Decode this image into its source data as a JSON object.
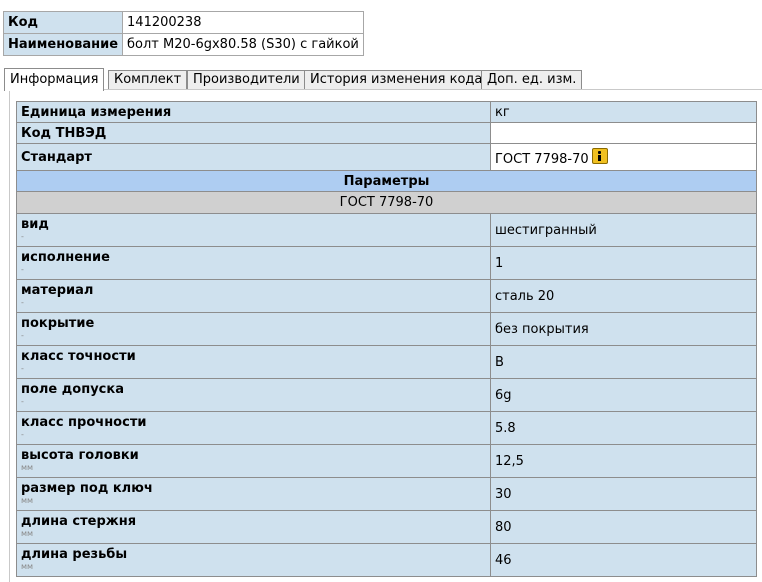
{
  "header": {
    "code_label": "Код",
    "code_value": "141200238",
    "name_label": "Наименование",
    "name_value": "болт М20-6gx80.58 (S30) с гайкой"
  },
  "tabs": [
    {
      "label": "Информация",
      "active": true
    },
    {
      "label": "Комплект",
      "active": false
    },
    {
      "label": "Производители",
      "active": false
    },
    {
      "label": "История изменения кода",
      "active": false
    },
    {
      "label": "Доп. ед. изм.",
      "active": false
    }
  ],
  "info": {
    "unit_label": "Единица измерения",
    "unit_value": "кг",
    "tnved_label": "Код ТНВЭД",
    "tnved_value": "",
    "standard_label": "Стандарт",
    "standard_value": "ГОСТ 7798-70"
  },
  "params_section": {
    "title": "Параметры",
    "standard": "ГОСТ 7798-70"
  },
  "params": [
    {
      "name": "вид",
      "unit": "-",
      "value": "шестигранный"
    },
    {
      "name": "исполнение",
      "unit": "-",
      "value": "1"
    },
    {
      "name": "материал",
      "unit": "-",
      "value": "сталь 20"
    },
    {
      "name": "покрытие",
      "unit": "-",
      "value": "без покрытия"
    },
    {
      "name": "класс точности",
      "unit": "-",
      "value": "В"
    },
    {
      "name": "поле допуска",
      "unit": "-",
      "value": "6g"
    },
    {
      "name": "класс прочности",
      "unit": "-",
      "value": "5.8"
    },
    {
      "name": "высота головки",
      "unit": "мм",
      "value": "12,5"
    },
    {
      "name": "размер под ключ",
      "unit": "мм",
      "value": "30"
    },
    {
      "name": "длина стержня",
      "unit": "мм",
      "value": "80"
    },
    {
      "name": "длина резьбы",
      "unit": "мм",
      "value": "46"
    }
  ],
  "icons": {
    "standard_info": "info-icon"
  },
  "colors": {
    "label_bg": "#cfe1ee",
    "section_bg": "#aecdf2",
    "standard_bg": "#d0d0d0",
    "info_icon": "#f0c020"
  }
}
